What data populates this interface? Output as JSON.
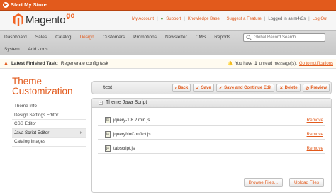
{
  "topbar": {
    "label": "Start My Store"
  },
  "logo": {
    "name": "Magento",
    "suffix": "go"
  },
  "toplinks": {
    "account": "My Account",
    "support": "Support",
    "knowledge": "Knowledge Base",
    "suggest": "Suggest a Feature",
    "logged": "Logged in as m4r3s",
    "logout": "Log Out"
  },
  "nav": {
    "row1": [
      "Dashboard",
      "Sales",
      "Catalog",
      "Design",
      "Customers",
      "Promotions",
      "Newsletter",
      "CMS",
      "Reports"
    ],
    "row2": [
      "System",
      "Add - ons"
    ],
    "active": "Design",
    "search_placeholder": "Global Record Search"
  },
  "notice": {
    "label": "Latest Finished Task:",
    "task": "Regenerate config task",
    "msg_prefix": "You have",
    "msg_count": "1",
    "msg_suffix": "unread message(s).",
    "inbox": "Go to notifications"
  },
  "sidebar": {
    "title": "Theme Customization",
    "items": [
      "Theme Info",
      "Design Settings Editor",
      "CSS Editor",
      "Java Script Editor",
      "Catalog Images"
    ],
    "active_index": 3
  },
  "theme_name": "test",
  "buttons": {
    "back": "Back",
    "save": "Save",
    "save_continue": "Save and Continue Edit",
    "delete": "Delete",
    "preview": "Preview"
  },
  "section": {
    "title": "Theme Java Script"
  },
  "files": [
    {
      "name": "jquery-1.8.2.min.js",
      "action": "Remove"
    },
    {
      "name": "jqueryNoConflict.js",
      "action": "Remove"
    },
    {
      "name": "tabscript.js",
      "action": "Remove"
    }
  ],
  "bottom": {
    "browse": "Browse Files...",
    "upload": "Upload Files"
  },
  "colors": {
    "accent": "#e25a1c"
  }
}
